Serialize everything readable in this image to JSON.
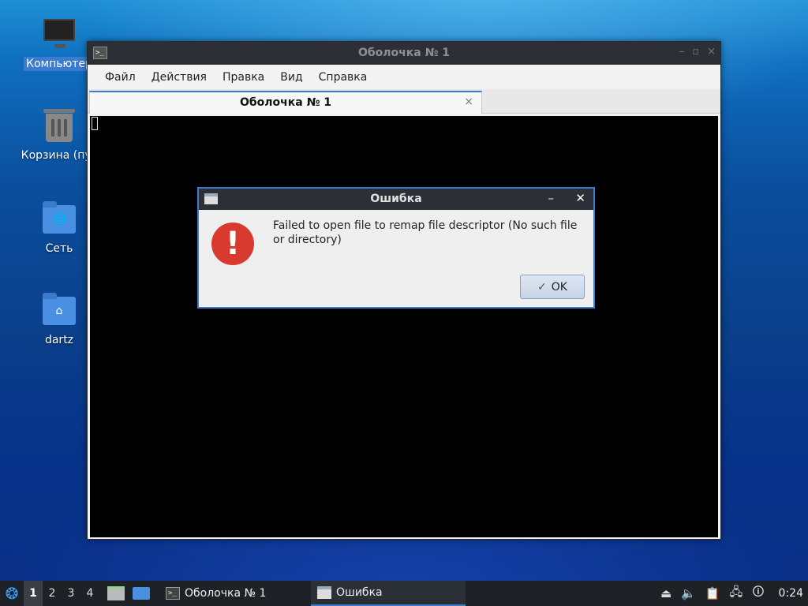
{
  "desktop": {
    "icons": [
      {
        "label": "Компьютер",
        "icon": "computer-icon"
      },
      {
        "label": "Корзина (пус",
        "icon": "trash-icon"
      },
      {
        "label": "Сеть",
        "icon": "network-folder-icon"
      },
      {
        "label": "dartz",
        "icon": "home-folder-icon"
      }
    ]
  },
  "terminal_window": {
    "title": "Оболочка № 1",
    "menu": [
      "Файл",
      "Действия",
      "Правка",
      "Вид",
      "Справка"
    ],
    "tab": {
      "label": "Оболочка № 1",
      "close": "×"
    },
    "window_buttons": {
      "minimize": "–",
      "maximize": "▫",
      "close": "×"
    }
  },
  "error_dialog": {
    "title": "Ошибка",
    "minimize": "–",
    "close": "✕",
    "message": "Failed to open file to remap file descriptor (No such file or directory)",
    "icon_glyph": "!",
    "ok_label": "OK",
    "ok_check": "✓"
  },
  "taskbar": {
    "menu_glyph": "❂",
    "workspaces": [
      "1",
      "2",
      "3",
      "4"
    ],
    "tasks": [
      {
        "label": "Оболочка № 1",
        "icon": "terminal-icon"
      },
      {
        "label": "Ошибка",
        "icon": "dialog-icon"
      }
    ],
    "tray": {
      "eject": "⏏",
      "volume": "🔈",
      "clipboard": "📋",
      "network": "🖧",
      "notify": "🛈"
    },
    "clock": "0:24"
  }
}
